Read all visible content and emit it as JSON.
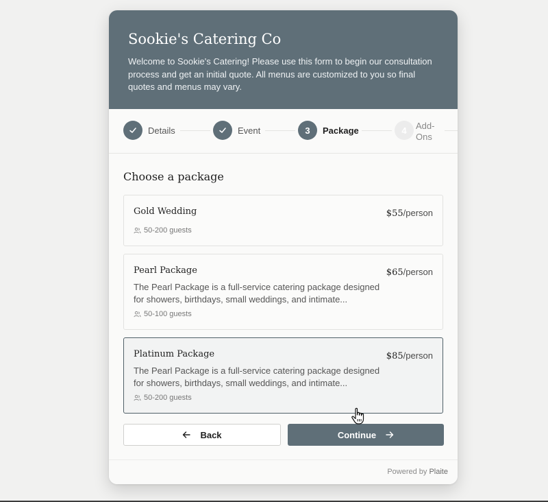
{
  "header": {
    "title": "Sookie's Catering Co",
    "intro": "Welcome to Sookie's Catering! Please use this form to begin our consultation process and get an initial quote. All menus are customized to you so final quotes and menus may vary."
  },
  "steps": [
    {
      "number": "1",
      "label": "Details",
      "state": "done"
    },
    {
      "number": "2",
      "label": "Event",
      "state": "done"
    },
    {
      "number": "3",
      "label": "Package",
      "state": "active"
    },
    {
      "number": "4",
      "label": "Add-Ons",
      "state": "pending"
    }
  ],
  "section_title": "Choose a package",
  "packages": [
    {
      "name": "Gold Wedding",
      "price": "$55",
      "unit": "/person",
      "description": "",
      "guests": "50-200 guests",
      "selected": false
    },
    {
      "name": "Pearl Package",
      "price": "$65",
      "unit": "/person",
      "description": "The Pearl Package is a full-service catering package designed for showers, birthdays, small weddings, and intimate...",
      "guests": "50-100 guests",
      "selected": false
    },
    {
      "name": "Platinum Package",
      "price": "$85",
      "unit": "/person",
      "description": "The Pearl Package is a full-service catering package designed for showers, birthdays, small weddings, and intimate...",
      "guests": "50-200 guests",
      "selected": true
    }
  ],
  "buttons": {
    "back": "Back",
    "continue": "Continue"
  },
  "footer": {
    "powered_by": "Powered by",
    "brand": "Plaite"
  },
  "colors": {
    "accent": "#5f6f78",
    "background": "#f1f1f0"
  }
}
